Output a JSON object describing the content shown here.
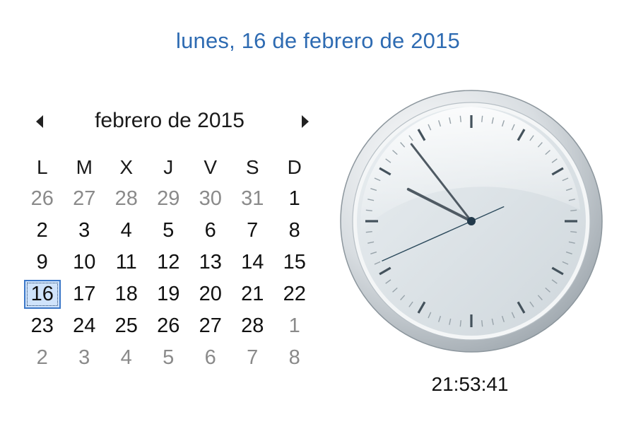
{
  "header": {
    "full_date": "lunes, 16 de febrero de 2015"
  },
  "calendar": {
    "month_title": "febrero de 2015",
    "prev_icon": "triangle-left-icon",
    "next_icon": "triangle-right-icon",
    "weekdays": [
      "L",
      "M",
      "X",
      "J",
      "V",
      "S",
      "D"
    ],
    "weeks": [
      [
        {
          "d": "26",
          "other": true
        },
        {
          "d": "27",
          "other": true
        },
        {
          "d": "28",
          "other": true
        },
        {
          "d": "29",
          "other": true
        },
        {
          "d": "30",
          "other": true
        },
        {
          "d": "31",
          "other": true
        },
        {
          "d": "1",
          "other": false
        }
      ],
      [
        {
          "d": "2",
          "other": false
        },
        {
          "d": "3",
          "other": false
        },
        {
          "d": "4",
          "other": false
        },
        {
          "d": "5",
          "other": false
        },
        {
          "d": "6",
          "other": false
        },
        {
          "d": "7",
          "other": false
        },
        {
          "d": "8",
          "other": false
        }
      ],
      [
        {
          "d": "9",
          "other": false
        },
        {
          "d": "10",
          "other": false
        },
        {
          "d": "11",
          "other": false
        },
        {
          "d": "12",
          "other": false
        },
        {
          "d": "13",
          "other": false
        },
        {
          "d": "14",
          "other": false
        },
        {
          "d": "15",
          "other": false
        }
      ],
      [
        {
          "d": "16",
          "other": false,
          "today": true
        },
        {
          "d": "17",
          "other": false
        },
        {
          "d": "18",
          "other": false
        },
        {
          "d": "19",
          "other": false
        },
        {
          "d": "20",
          "other": false
        },
        {
          "d": "21",
          "other": false
        },
        {
          "d": "22",
          "other": false
        }
      ],
      [
        {
          "d": "23",
          "other": false
        },
        {
          "d": "24",
          "other": false
        },
        {
          "d": "25",
          "other": false
        },
        {
          "d": "26",
          "other": false
        },
        {
          "d": "27",
          "other": false
        },
        {
          "d": "28",
          "other": false
        },
        {
          "d": "1",
          "other": true
        }
      ],
      [
        {
          "d": "2",
          "other": true
        },
        {
          "d": "3",
          "other": true
        },
        {
          "d": "4",
          "other": true
        },
        {
          "d": "5",
          "other": true
        },
        {
          "d": "6",
          "other": true
        },
        {
          "d": "7",
          "other": true
        },
        {
          "d": "8",
          "other": true
        }
      ]
    ]
  },
  "clock": {
    "time": "21:53:41",
    "hours": 21,
    "minutes": 53,
    "seconds": 41
  },
  "colors": {
    "accent": "#2e6bb2",
    "today_fill": "#cfe3fb",
    "today_border": "#3c78c8",
    "other_month_text": "#8a8a8a"
  }
}
